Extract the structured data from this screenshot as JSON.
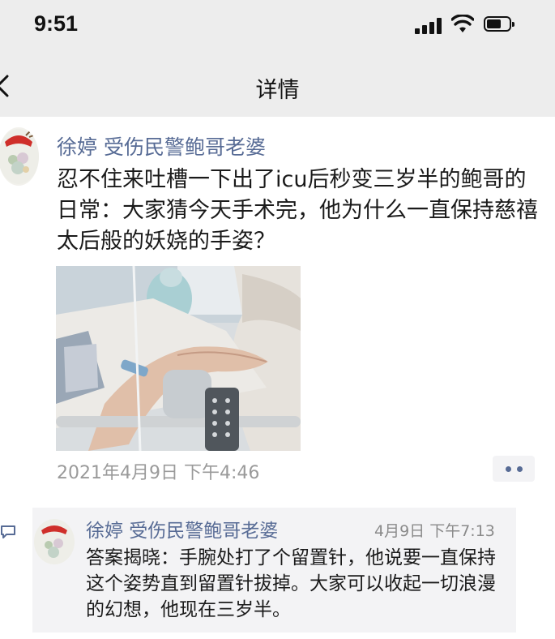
{
  "status_bar": {
    "time": "9:51"
  },
  "nav": {
    "title": "详情",
    "back_icon": "chevron-left-icon"
  },
  "post": {
    "author": "徐婷 受伤民警鲍哥老婆",
    "text": "忍不住来吐槽一下出了icu后秒变三岁半的鲍哥的日常：大家猜今天手术完，他为什么一直保持慈禧太后般的妖娆的手姿？",
    "date": "2021年4月9日 下午4:46",
    "more_icon": "ellipsis-icon"
  },
  "comment": {
    "author": "徐婷 受伤民警鲍哥老婆",
    "time": "4月9日 下午7:13",
    "text": "答案揭晓：手腕处打了个留置针，他说要一直保持这个姿势直到留置针拔掉。大家可以收起一切浪漫的幻想，他现在三岁半。",
    "icon": "comment-bubble-icon"
  },
  "colors": {
    "link": "#576b95",
    "bar": "#ededed",
    "comment_bg": "#f3f3f5"
  }
}
